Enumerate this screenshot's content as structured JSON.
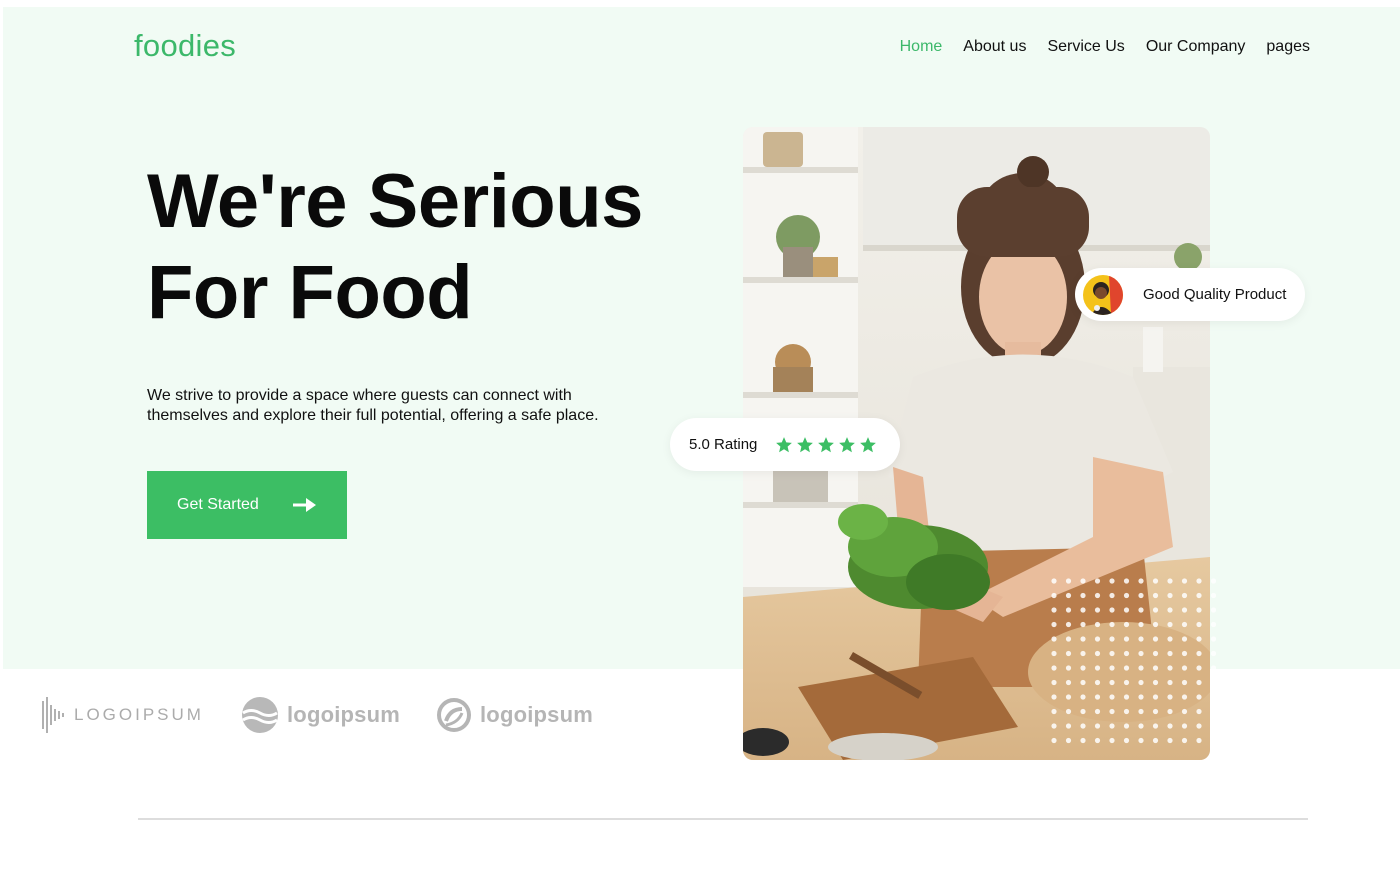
{
  "brand": {
    "name": "foodies",
    "accent": "#3cb86a"
  },
  "nav": {
    "items": [
      "Home",
      "About us",
      "Service Us",
      "Our Company",
      "pages"
    ],
    "active": "Home"
  },
  "hero": {
    "headline_line1": "We're Serious",
    "headline_line2": "For Food",
    "description_line1": "We strive to provide a space where guests can connect with",
    "description_line2": "themselves and explore their full potential, offering a safe place.",
    "cta_label": "Get Started",
    "cta_icon": "arrow-right-icon",
    "background_color": "#f1fbf4"
  },
  "badges": {
    "quality_label": "Good Quality Product",
    "rating_label": "5.0 Rating",
    "rating_value": 5,
    "star_icon": "star-icon",
    "star_color": "#3cbe64"
  },
  "partners": [
    "LOGOIPSUM",
    "logoipsum",
    "logoipsum"
  ]
}
